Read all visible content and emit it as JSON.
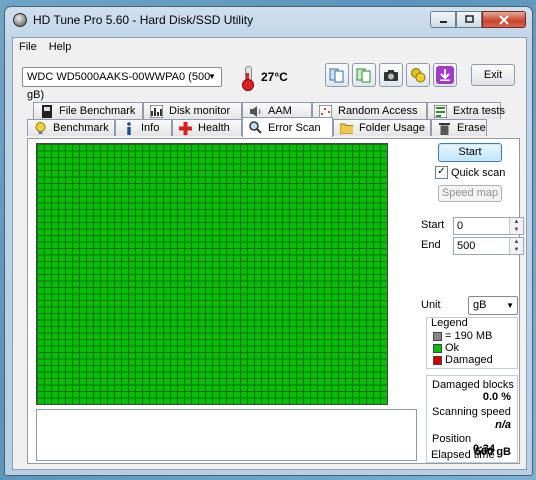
{
  "window": {
    "title": "HD Tune Pro 5.60 - Hard Disk/SSD Utility"
  },
  "menu": {
    "file": "File",
    "help": "Help"
  },
  "toolbar": {
    "drive": "WDC WD5000AAKS-00WWPA0 (500 gB)",
    "temperature": "27°C",
    "exit_label": "Exit"
  },
  "tabs_top": [
    {
      "label": "File Benchmark"
    },
    {
      "label": "Disk monitor"
    },
    {
      "label": "AAM"
    },
    {
      "label": "Random Access"
    },
    {
      "label": "Extra tests"
    }
  ],
  "tabs_bottom": [
    {
      "label": "Benchmark"
    },
    {
      "label": "Info"
    },
    {
      "label": "Health"
    },
    {
      "label": "Error Scan"
    },
    {
      "label": "Folder Usage"
    },
    {
      "label": "Erase"
    }
  ],
  "controls": {
    "start_label": "Start",
    "quick_scan_label": "Quick scan",
    "quick_scan_checked": true,
    "speed_map_label": "Speed map",
    "start_field_label": "Start",
    "start_value": "0",
    "end_field_label": "End",
    "end_value": "500",
    "unit_label": "Unit",
    "unit_value": "gB"
  },
  "legend": {
    "title": "Legend",
    "items": [
      {
        "label": "= 190 MB",
        "color": "#888888"
      },
      {
        "label": "Ok",
        "color": "#00c000"
      },
      {
        "label": "Damaged",
        "color": "#d00000"
      }
    ]
  },
  "stats": {
    "damaged_blocks_label": "Damaged blocks",
    "damaged_blocks_value": "0.0 %",
    "scanning_speed_label": "Scanning speed",
    "scanning_speed_value": "n/a",
    "position_label": "Position",
    "position_value": "500 gB",
    "elapsed_label": "Elapsed time",
    "elapsed_value": "0:34"
  },
  "colors": {
    "ok": "#00c000",
    "grid_line": "#1a6e1a",
    "accent": "#3c7fb1"
  }
}
